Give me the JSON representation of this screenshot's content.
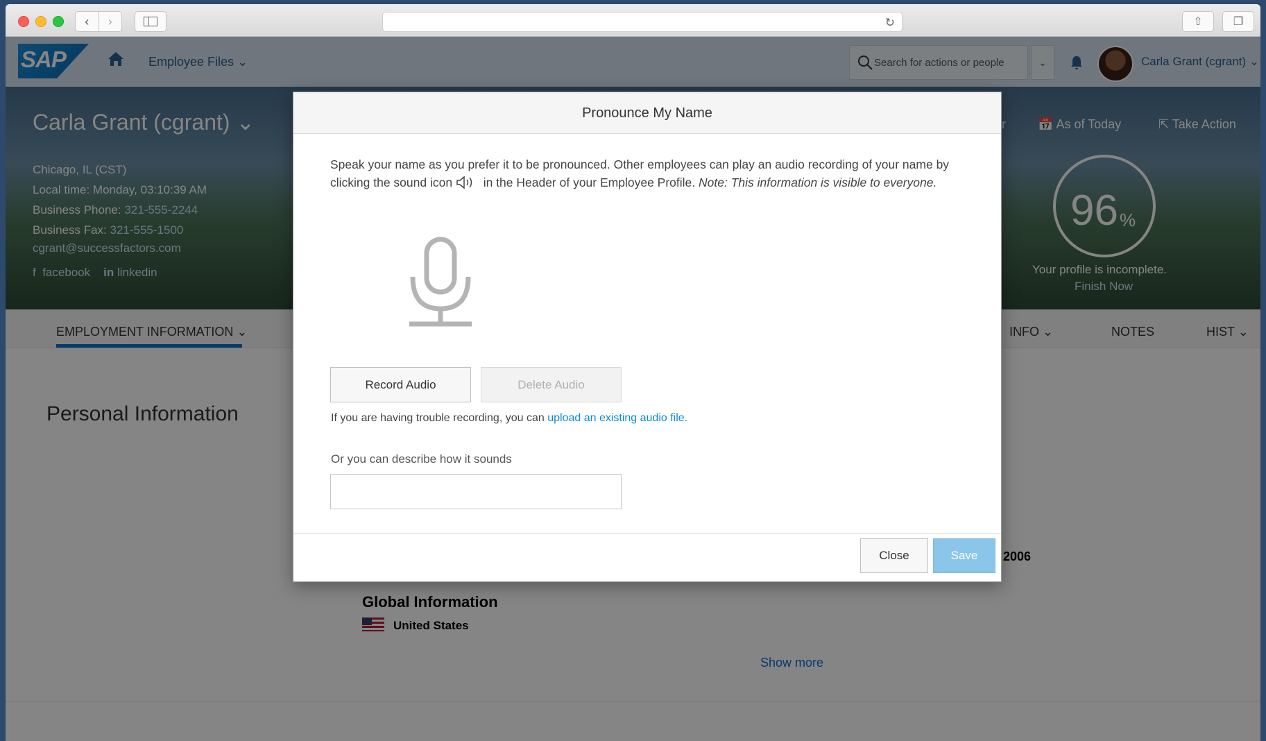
{
  "shell": {
    "logo": "SAP",
    "nav_menu": "Employee Files",
    "search_placeholder": "Search for actions or people",
    "user_name": "Carla Grant (cgrant)"
  },
  "profile": {
    "name": "Carla Grant (cgrant)",
    "location": "Chicago, IL (CST)",
    "local_time": "Local time: Monday, 03:10:39 AM",
    "business_phone_label": "Business Phone:",
    "business_phone": "321-555-2244",
    "business_fax_label": "Business Fax:",
    "business_fax": "321-555-1500",
    "email": "cgrant@successfactors.com",
    "facebook": "facebook",
    "linkedin": "linkedin",
    "partial_action": "er",
    "as_of_today": "As of Today",
    "take_action": "Take Action",
    "completion_value": "96",
    "completion_unit": "%",
    "incomplete_text": "Your profile is incomplete.",
    "finish_now": "Finish Now"
  },
  "tabs": {
    "employment": "EMPLOYMENT INFORMATION",
    "info_partial": "INFO",
    "notes": "NOTES",
    "hist": "HIST"
  },
  "content": {
    "personal_info_title": "Personal Information",
    "year": "2006",
    "global_info_title": "Global Information",
    "country": "United States",
    "show_more": "Show more"
  },
  "dialog": {
    "title": "Pronounce My Name",
    "desc_part1": "Speak your name as you prefer it to be pronounced. Other employees can play an audio recording of your name by clicking the sound icon",
    "desc_part2": "in the Header of your Employee Profile.",
    "desc_note": "Note: This information is visible to everyone.",
    "record_audio": "Record Audio",
    "delete_audio": "Delete Audio",
    "trouble_text": "If you are having trouble recording, you can",
    "upload_link": "upload an existing audio file.",
    "describe_label": "Or you can describe how it sounds",
    "describe_value": "",
    "close": "Close",
    "save": "Save"
  }
}
